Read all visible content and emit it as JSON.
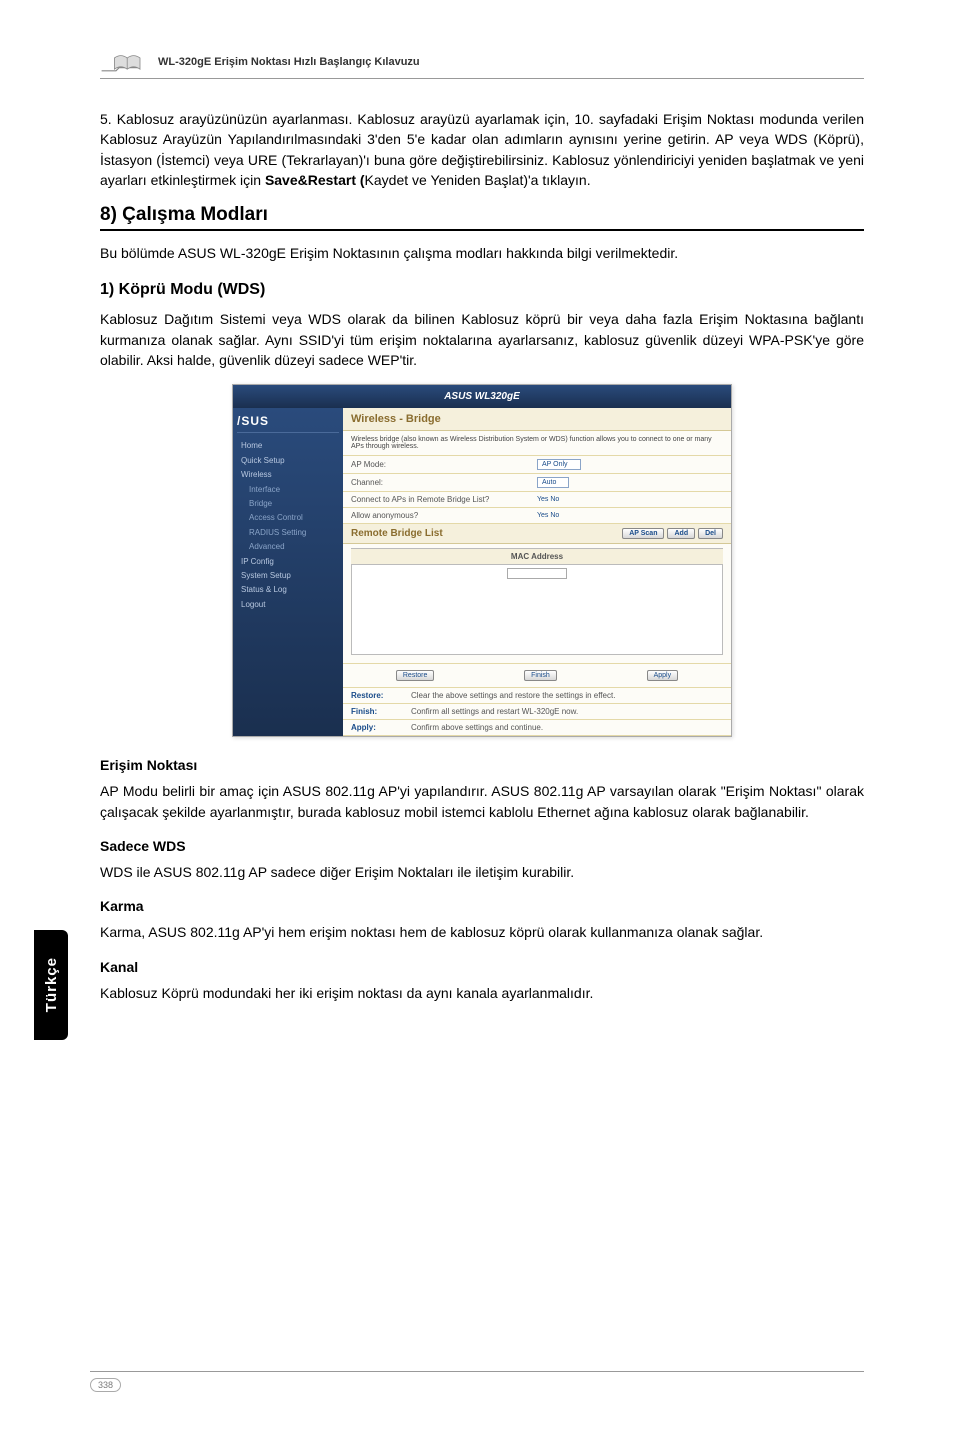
{
  "header": {
    "title": "WL-320gE Erişim Noktası Hızlı Başlangıç Kılavuzu"
  },
  "para1": "5. Kablosuz arayüzünüzün ayarlanması. Kablosuz arayüzü ayarlamak için, 10. sayfadaki Erişim Noktası modunda verilen Kablosuz Arayüzün Yapılandırılmasındaki 3'den 5'e kadar olan adımların aynısını yerine getirin. AP veya WDS (Köprü), İstasyon (İstemci) veya URE (Tekrarlayan)'ı buna göre değiştirebilirsiniz. Kablosuz yönlendiriciyi yeniden başlatmak ve yeni ayarları etkinleştirmek için ",
  "para1_bold": "Save&Restart  (",
  "para1_after": "Kaydet ve Yeniden Başlat)'a tıklayın.",
  "section8": "8) Çalışma Modları",
  "para2": "Bu bölümde ASUS WL-320gE Erişim Noktasının çalışma modları hakkında bilgi verilmektedir.",
  "sub1": "1)  Köprü Modu (WDS)",
  "para3": "Kablosuz Dağıtım Sistemi veya WDS olarak da bilinen Kablosuz köprü bir veya daha fazla Erişim Noktasına bağlantı kurmanıza olanak sağlar. Aynı SSID'yi tüm erişim noktalarına ayarlarsanız, kablosuz güvenlik düzeyi WPA-PSK'ye göre olabilir. Aksi halde, güvenlik düzeyi sadece WEP'tir.",
  "screenshot": {
    "top": "ASUS WL320gE",
    "logo": "/SUS",
    "nav": [
      "Home",
      "Quick Setup",
      "Wireless",
      "Interface",
      "Bridge",
      "Access Control",
      "RADIUS Setting",
      "Advanced",
      "IP Config",
      "System Setup",
      "Status & Log",
      "Logout"
    ],
    "title": "Wireless - Bridge",
    "desc": "Wireless bridge (also known as Wireless Distribution System or WDS) function allows you to connect to one or many APs through wireless.",
    "rows": {
      "apmode_label": "AP Mode:",
      "apmode_val": "AP Only",
      "channel_label": "Channel:",
      "channel_val": "Auto",
      "connect_label": "Connect to APs in Remote Bridge List?",
      "connect_val": "Yes   No",
      "allow_label": "Allow anonymous?",
      "allow_val": "Yes   No"
    },
    "subtitle": "Remote Bridge List",
    "btns": [
      "AP Scan",
      "Add",
      "Del"
    ],
    "mac_head": "MAC Address",
    "bottom_btns": [
      "Restore",
      "Finish",
      "Apply"
    ],
    "actions": [
      {
        "label": "Restore:",
        "desc": "Clear the above settings and restore the settings in effect."
      },
      {
        "label": "Finish:",
        "desc": "Confirm all settings and restart WL-320gE now."
      },
      {
        "label": "Apply:",
        "desc": "Confirm above settings and continue."
      }
    ]
  },
  "h_erisim": "Erişim Noktası",
  "p_erisim": "AP Modu belirli bir amaç için ASUS 802.11g AP'yi yapılandırır. ASUS 802.11g AP varsayılan olarak \"Erişim Noktası\" olarak çalışacak şekilde ayarlanmıştır, burada kablosuz mobil istemci kablolu Ethernet ağına kablosuz olarak bağlanabilir.",
  "h_sadece": "Sadece WDS",
  "p_sadece": "WDS ile ASUS 802.11g AP sadece diğer Erişim Noktaları ile iletişim kurabilir.",
  "h_karma": "Karma",
  "p_karma": "Karma, ASUS 802.11g AP'yi hem erişim noktası hem de kablosuz köprü olarak kullanmanıza olanak sağlar.",
  "h_kanal": "Kanal",
  "p_kanal": "Kablosuz Köprü modundaki her iki erişim noktası da aynı kanala ayarlanmalıdır.",
  "side_tab": "Türkçe",
  "page_number": "338"
}
